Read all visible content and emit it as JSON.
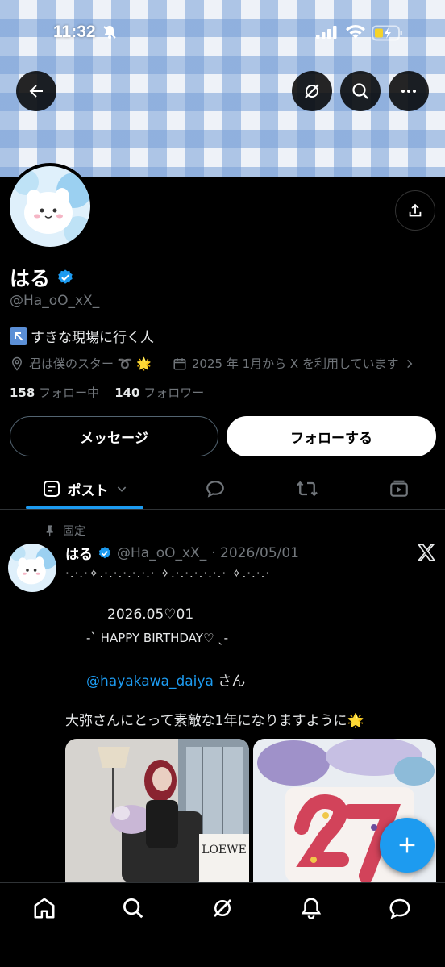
{
  "status": {
    "time": "11:32"
  },
  "profile": {
    "name": "はる",
    "handle": "@Ha_oO_xX_",
    "bio": "すきな現場に行く人",
    "location": "君は僕のスター ➰ 🌟",
    "joined": "2025 年 1月から X を利用しています",
    "following_count": "158",
    "following_label": "フォロー中",
    "followers_count": "140",
    "followers_label": "フォロワー"
  },
  "actions": {
    "message": "メッセージ",
    "follow": "フォローする"
  },
  "tabs": {
    "posts": "ポスト"
  },
  "post": {
    "pinned_label": "固定",
    "name": "はる",
    "handle": "@Ha_oO_xX_",
    "date": "· 2026/05/01",
    "line1": "·.·.·✧.·.·.·.·.·.· ✧.·.·.·.·.·.· ✧.·.·.·",
    "line2": "2026.05♡01",
    "line3": "-ˋ HAPPY BIRTHDAY♡ ˎ-",
    "mention": "@hayakawa_daiya",
    "mention_suffix": " さん",
    "line5": "大弥さんにとって素敵な1年になりますように🌟",
    "media_text": "LOEWE"
  },
  "colors": {
    "accent": "#1d9bf0",
    "verified": "#1d9bf0"
  }
}
